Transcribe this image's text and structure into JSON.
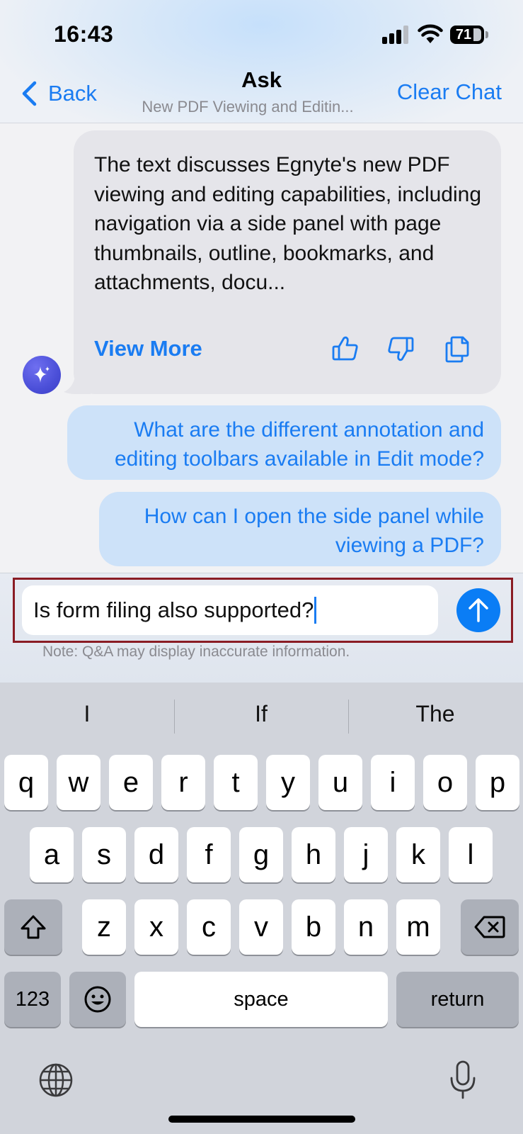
{
  "status_bar": {
    "time": "16:43",
    "battery": "71"
  },
  "nav": {
    "back_label": "Back",
    "title": "Ask",
    "subtitle": "New PDF Viewing and Editin...",
    "clear_label": "Clear Chat"
  },
  "chat": {
    "ai_message": "The text discusses Egnyte's new PDF viewing and editing capabilities, including navigation via a side panel with page thumbnails, outline, bookmarks, and attachments, docu...",
    "view_more_label": "View More",
    "user_messages": [
      "What are the different annotation and editing toolbars available in Edit mode?",
      "How can I open the side panel while viewing a PDF?"
    ]
  },
  "composer": {
    "input_value": "Is form filing also supported?",
    "disclaimer": "Note: Q&A may display inaccurate information."
  },
  "keyboard": {
    "suggestions": [
      "I",
      "If",
      "The"
    ],
    "row1": [
      "q",
      "w",
      "e",
      "r",
      "t",
      "y",
      "u",
      "i",
      "o",
      "p"
    ],
    "row2": [
      "a",
      "s",
      "d",
      "f",
      "g",
      "h",
      "j",
      "k",
      "l"
    ],
    "row3": [
      "z",
      "x",
      "c",
      "v",
      "b",
      "n",
      "m"
    ],
    "numbers_label": "123",
    "space_label": "space",
    "return_label": "return"
  },
  "colors": {
    "accent": "#1a7cf2",
    "user_bubble": "#cde2f9",
    "ai_bubble": "#e5e5ea",
    "send_button": "#0a7df5",
    "highlight_frame": "#8a1c24"
  }
}
